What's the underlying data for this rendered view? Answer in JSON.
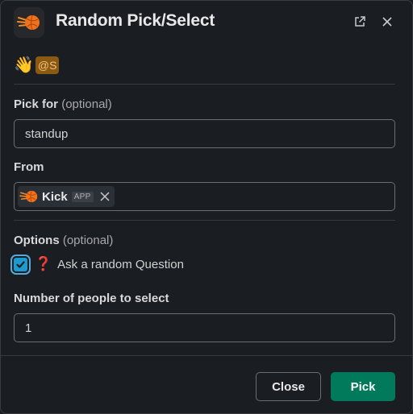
{
  "header": {
    "title": "Random Pick/Select",
    "app_icon": "orange-ball-icon",
    "popout_icon": "external-link-icon",
    "close_icon": "close-icon"
  },
  "greeting": {
    "emoji": "👋",
    "mention": "@S"
  },
  "pick_for": {
    "label": "Pick for",
    "optional": "(optional)",
    "value": "standup"
  },
  "from": {
    "label": "From",
    "chip_name": "Kick",
    "chip_badge": "APP"
  },
  "options": {
    "label": "Options",
    "optional": "(optional)",
    "checkbox_checked": true,
    "question_emoji": "❓",
    "checkbox_label": "Ask a random Question"
  },
  "number": {
    "label": "Number of people to select",
    "value": "1"
  },
  "footer": {
    "close_label": "Close",
    "pick_label": "Pick"
  },
  "colors": {
    "background": "#1a1d21",
    "pick_button": "#007a5a",
    "checkbox": "#1d9bd1",
    "mention_bg": "#8a5a12"
  }
}
